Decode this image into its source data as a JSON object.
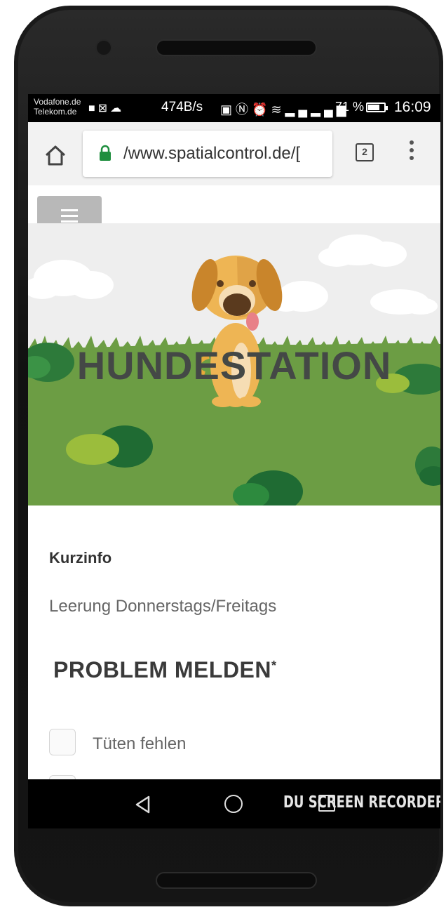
{
  "status_bar": {
    "carrier_1": "Vodafone.de",
    "carrier_2": "Telekom.de",
    "data_rate": "474B/s",
    "battery_percent": "71 %",
    "battery_level": 0.71,
    "time": "16:09"
  },
  "browser": {
    "url": "/www.spatialcontrol.de/[",
    "tab_count": "2"
  },
  "page": {
    "hero_title": "HUNDESTATION",
    "kurzinfo_title": "Kurzinfo",
    "kurzinfo_text": "Leerung Donnerstags/Freitags",
    "problem_title": "PROBLEM MELDEN",
    "problem_required_mark": "*",
    "checkbox_items": [
      {
        "label": "Tüten fehlen",
        "checked": false
      },
      {
        "label": "",
        "checked": false
      }
    ]
  },
  "nav_bar": {
    "watermark": "DU SCREEN RECORDER"
  },
  "colors": {
    "hero_grass": "#6c9d44",
    "hero_sky": "#eeeeee",
    "url_lock": "#1e8e3e",
    "hamburger_bg": "#b8b8b8"
  }
}
